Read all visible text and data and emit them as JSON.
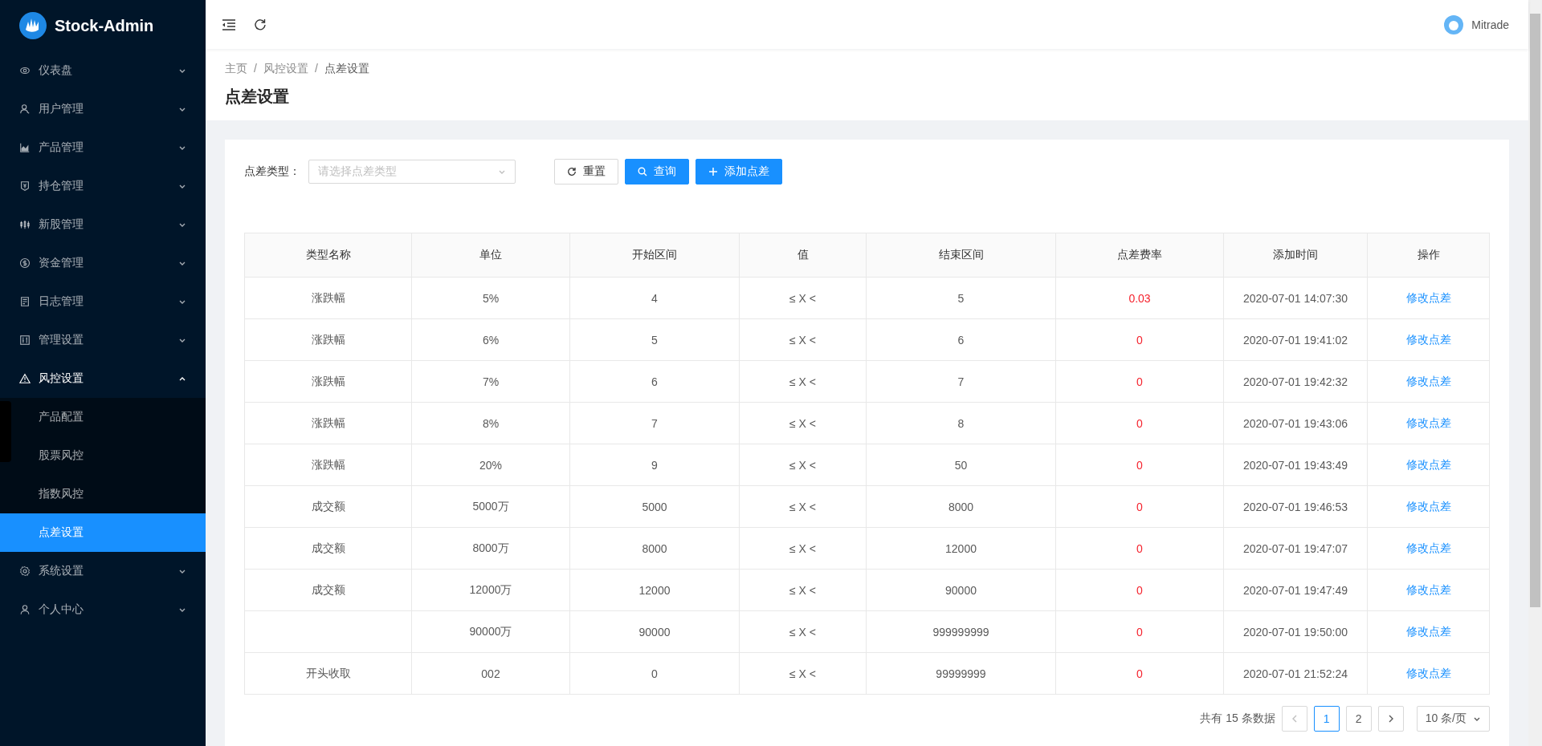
{
  "sidebar": {
    "logo": "Stock-Admin",
    "items": [
      {
        "label": "仪表盘",
        "expanded": false
      },
      {
        "label": "用户管理",
        "expanded": false
      },
      {
        "label": "产品管理",
        "expanded": false
      },
      {
        "label": "持仓管理",
        "expanded": false
      },
      {
        "label": "新股管理",
        "expanded": false
      },
      {
        "label": "资金管理",
        "expanded": false
      },
      {
        "label": "日志管理",
        "expanded": false
      },
      {
        "label": "管理设置",
        "expanded": false
      },
      {
        "label": "风控设置",
        "expanded": true,
        "children": [
          {
            "label": "产品配置",
            "selected": false
          },
          {
            "label": "股票风控",
            "selected": false
          },
          {
            "label": "指数风控",
            "selected": false
          },
          {
            "label": "点差设置",
            "selected": true
          }
        ]
      },
      {
        "label": "系统设置",
        "expanded": false
      },
      {
        "label": "个人中心",
        "expanded": false
      }
    ]
  },
  "header": {
    "user": "Mitrade"
  },
  "breadcrumb": {
    "separator": "/",
    "items": [
      "主页",
      "风控设置",
      "点差设置"
    ]
  },
  "page_title": "点差设置",
  "filter": {
    "label": "点差类型：",
    "placeholder": "请选择点差类型",
    "buttons": [
      {
        "label": "重置",
        "kind": "reset"
      },
      {
        "label": "查询",
        "kind": "search"
      },
      {
        "label": "添加点差",
        "kind": "add"
      }
    ]
  },
  "table": {
    "columns": [
      "类型名称",
      "单位",
      "开始区间",
      "值",
      "结束区间",
      "点差费率",
      "添加时间",
      "操作"
    ],
    "rows": [
      {
        "type": "涨跌幅",
        "unit": "5%",
        "start": "4",
        "op": "≤ X <",
        "end": "5",
        "rate": "0.03",
        "time": "2020-07-01 14:07:30",
        "action": "修改点差"
      },
      {
        "type": "涨跌幅",
        "unit": "6%",
        "start": "5",
        "op": "≤ X <",
        "end": "6",
        "rate": "0",
        "time": "2020-07-01 19:41:02",
        "action": "修改点差"
      },
      {
        "type": "涨跌幅",
        "unit": "7%",
        "start": "6",
        "op": "≤ X <",
        "end": "7",
        "rate": "0",
        "time": "2020-07-01 19:42:32",
        "action": "修改点差"
      },
      {
        "type": "涨跌幅",
        "unit": "8%",
        "start": "7",
        "op": "≤ X <",
        "end": "8",
        "rate": "0",
        "time": "2020-07-01 19:43:06",
        "action": "修改点差"
      },
      {
        "type": "涨跌幅",
        "unit": "20%",
        "start": "9",
        "op": "≤ X <",
        "end": "50",
        "rate": "0",
        "time": "2020-07-01 19:43:49",
        "action": "修改点差"
      },
      {
        "type": "成交额",
        "unit": "5000万",
        "start": "5000",
        "op": "≤ X <",
        "end": "8000",
        "rate": "0",
        "time": "2020-07-01 19:46:53",
        "action": "修改点差"
      },
      {
        "type": "成交额",
        "unit": "8000万",
        "start": "8000",
        "op": "≤ X <",
        "end": "12000",
        "rate": "0",
        "time": "2020-07-01 19:47:07",
        "action": "修改点差"
      },
      {
        "type": "成交额",
        "unit": "12000万",
        "start": "12000",
        "op": "≤ X <",
        "end": "90000",
        "rate": "0",
        "time": "2020-07-01 19:47:49",
        "action": "修改点差"
      },
      {
        "unit": "90000万",
        "start": "90000",
        "op": "≤ X <",
        "end": "999999999",
        "rate": "0",
        "time": "2020-07-01 19:50:00",
        "action": "修改点差"
      },
      {
        "type": "开头收取",
        "unit": "002",
        "start": "0",
        "op": "≤ X <",
        "end": "99999999",
        "rate": "0",
        "time": "2020-07-01 21:52:24",
        "action": "修改点差"
      }
    ]
  },
  "pagination": {
    "total": "共有 15 条数据",
    "pages": [
      {
        "label": "1",
        "selected": true
      },
      {
        "label": "2",
        "selected": false
      }
    ],
    "page_size": "10 条/页"
  }
}
